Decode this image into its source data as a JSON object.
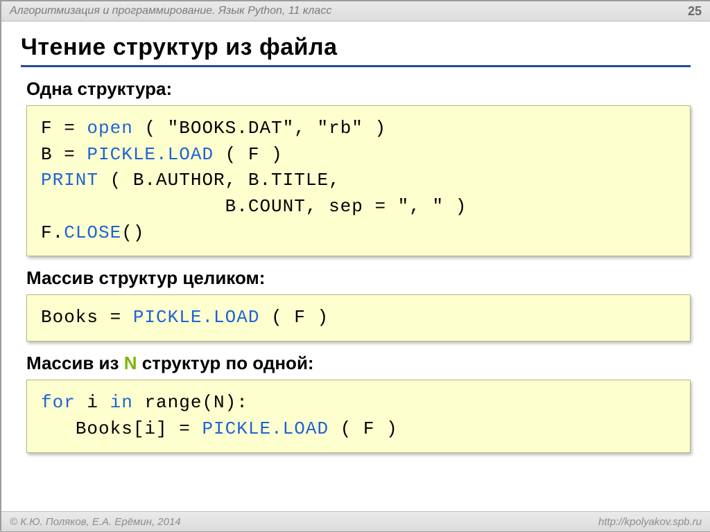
{
  "header": {
    "course": "Алгоритмизация и программирование. Язык Python, 11 класс",
    "page": "25"
  },
  "title": "Чтение структур из файла",
  "sections": {
    "s1": "Одна структура:",
    "s2": "Массив структур целиком:",
    "s3_a": "Массив из ",
    "s3_n": "N",
    "s3_b": " структур по одной:"
  },
  "code1": {
    "l1a": "F",
    "l1eq": " = ",
    "l1open": "open",
    "l1b": " ( \"BOOKS.DAT\", \"rb\" )",
    "l2a": "B",
    "l2eq": " = ",
    "l2pk": "PICKLE.LOAD",
    "l2b": " ( F )",
    "l3print": "PRINT",
    "l3b": " ( B.AUTHOR, B.TITLE,",
    "l4pad": "                ",
    "l4b": "B.COUNT, sep = \", \" )",
    "l5a": "F.",
    "l5close": "CLOSE",
    "l5b": "()"
  },
  "code2": {
    "l1a": "Books",
    "l1eq": " = ",
    "l1pk": "PICKLE.LOAD",
    "l1b": " ( F )"
  },
  "code3": {
    "l1for": "for",
    "l1a": " i ",
    "l1in": "in",
    "l1b": " range(N):",
    "l2pad": "   ",
    "l2a": "Books[i]",
    "l2eq": " = ",
    "l2pk": "PICKLE.LOAD",
    "l2b": " ( F )"
  },
  "footer": {
    "copyright": "© К.Ю. Поляков, Е.А. Ерёмин, 2014",
    "url": "http://kpolyakov.spb.ru"
  }
}
